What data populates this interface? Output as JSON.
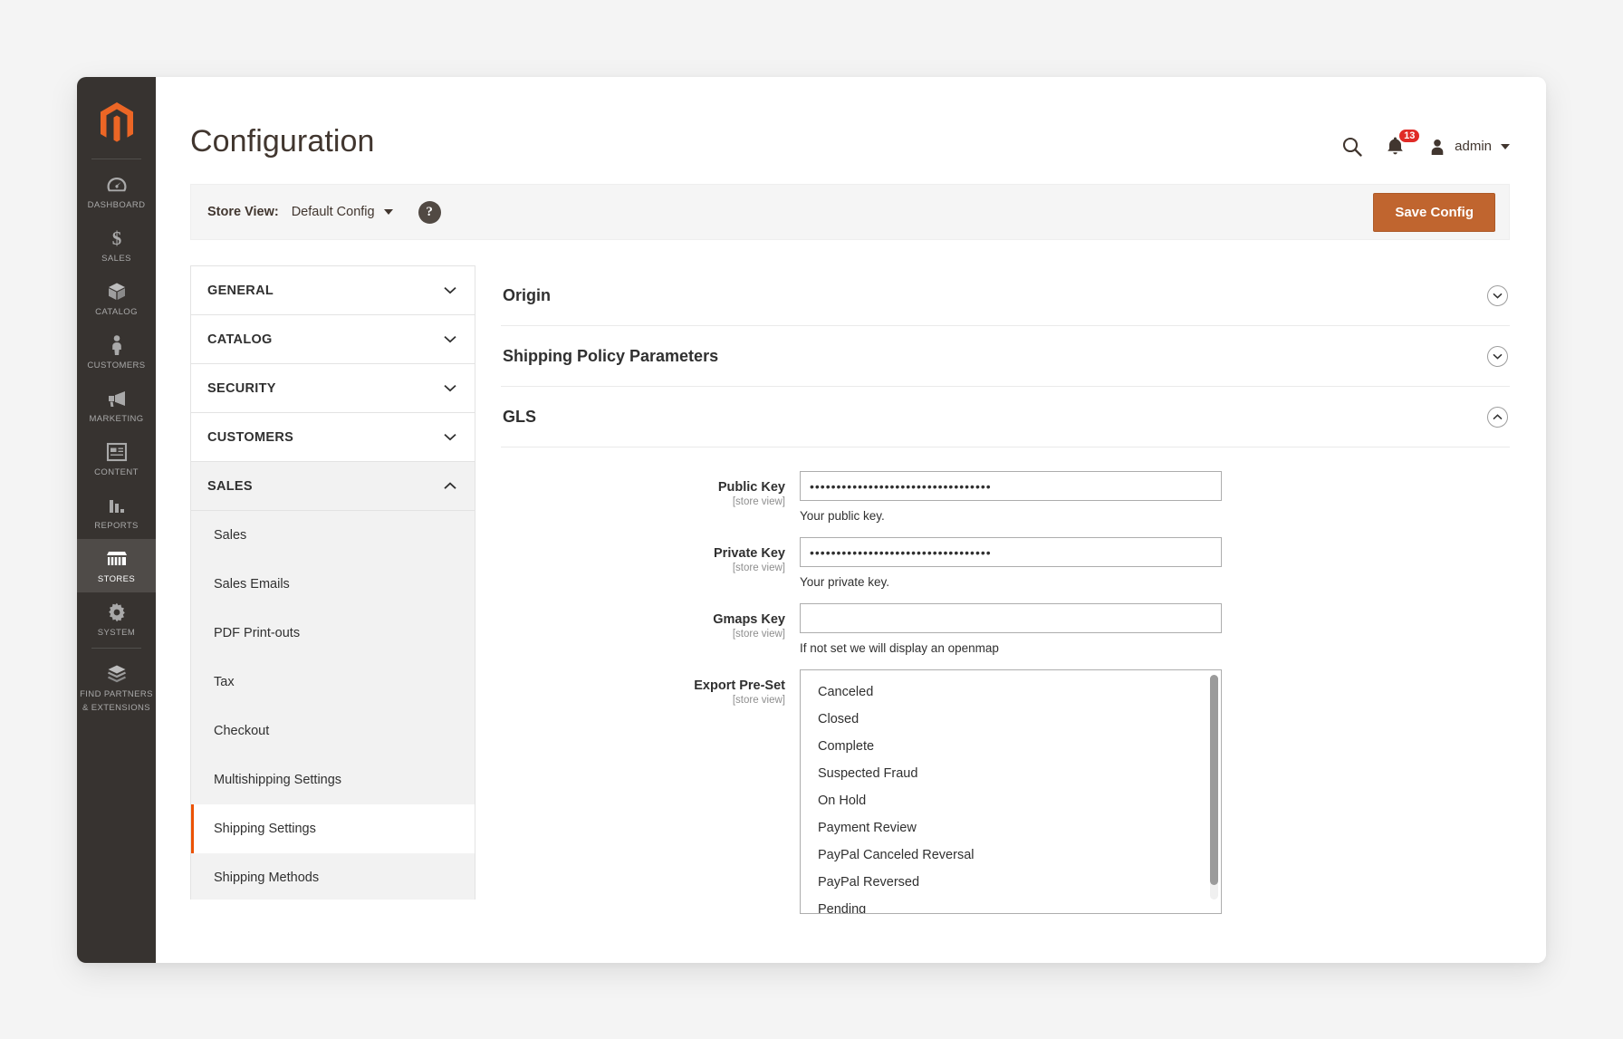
{
  "admin_nav": {
    "logo_name": "magento-logo",
    "items": [
      {
        "label": "Dashboard",
        "icon": "gauge-icon",
        "active": false
      },
      {
        "label": "Sales",
        "icon": "dollar-icon",
        "active": false
      },
      {
        "label": "Catalog",
        "icon": "box-icon",
        "active": false
      },
      {
        "label": "Customers",
        "icon": "person-icon",
        "active": false
      },
      {
        "label": "Marketing",
        "icon": "megaphone-icon",
        "active": false
      },
      {
        "label": "Content",
        "icon": "layout-icon",
        "active": false
      },
      {
        "label": "Reports",
        "icon": "bar-chart-icon",
        "active": false
      },
      {
        "label": "Stores",
        "icon": "storefront-icon",
        "active": true
      },
      {
        "label": "System",
        "icon": "gear-icon",
        "active": false
      },
      {
        "label": "Find Partners\n& Extensions",
        "icon": "extensions-icon",
        "active": false
      }
    ],
    "item_labels": {
      "dashboard": "DASHBOARD",
      "sales": "SALES",
      "catalog": "CATALOG",
      "customers": "CUSTOMERS",
      "marketing": "MARKETING",
      "content": "CONTENT",
      "reports": "REPORTS",
      "stores": "STORES",
      "system": "SYSTEM",
      "partners_line1": "FIND PARTNERS",
      "partners_line2": "& EXTENSIONS"
    }
  },
  "header": {
    "title": "Configuration",
    "search_icon": "search-icon",
    "notifications_count": "13",
    "user_name": "admin"
  },
  "store_bar": {
    "label": "Store View:",
    "selected": "Default Config",
    "help_glyph": "?",
    "save_label": "Save Config"
  },
  "accordion": {
    "sections": [
      {
        "label": "GENERAL",
        "open": false
      },
      {
        "label": "CATALOG",
        "open": false
      },
      {
        "label": "SECURITY",
        "open": false
      },
      {
        "label": "CUSTOMERS",
        "open": false
      },
      {
        "label": "SALES",
        "open": true
      }
    ],
    "sales_children": [
      {
        "label": "Sales",
        "active": false
      },
      {
        "label": "Sales Emails",
        "active": false
      },
      {
        "label": "PDF Print-outs",
        "active": false
      },
      {
        "label": "Tax",
        "active": false
      },
      {
        "label": "Checkout",
        "active": false
      },
      {
        "label": "Multishipping Settings",
        "active": false
      },
      {
        "label": "Shipping Settings",
        "active": true
      },
      {
        "label": "Shipping Methods",
        "active": false
      }
    ]
  },
  "settings": {
    "sections": [
      {
        "title": "Origin",
        "state": "collapsed"
      },
      {
        "title": "Shipping Policy Parameters",
        "state": "collapsed"
      },
      {
        "title": "GLS",
        "state": "expanded"
      }
    ],
    "gls_fields": {
      "public_key": {
        "label": "Public Key",
        "scope": "[store view]",
        "value": "••••••••••••••••••••••••••••••••••",
        "note": "Your public key."
      },
      "private_key": {
        "label": "Private Key",
        "scope": "[store view]",
        "value": "••••••••••••••••••••••••••••••••••",
        "note": "Your private key."
      },
      "gmaps_key": {
        "label": "Gmaps Key",
        "scope": "[store view]",
        "value": "",
        "note": "If not set we will display an openmap"
      },
      "export_preset": {
        "label": "Export Pre-Set",
        "scope": "[store view]",
        "options": [
          "Canceled",
          "Closed",
          "Complete",
          "Suspected Fraud",
          "On Hold",
          "Payment Review",
          "PayPal Canceled Reversal",
          "PayPal Reversed",
          "Pending"
        ]
      }
    }
  },
  "colors": {
    "brand_orange": "#eb5202",
    "save_button": "#c0652f",
    "nav_bg": "#373330",
    "badge_red": "#e02b27"
  }
}
